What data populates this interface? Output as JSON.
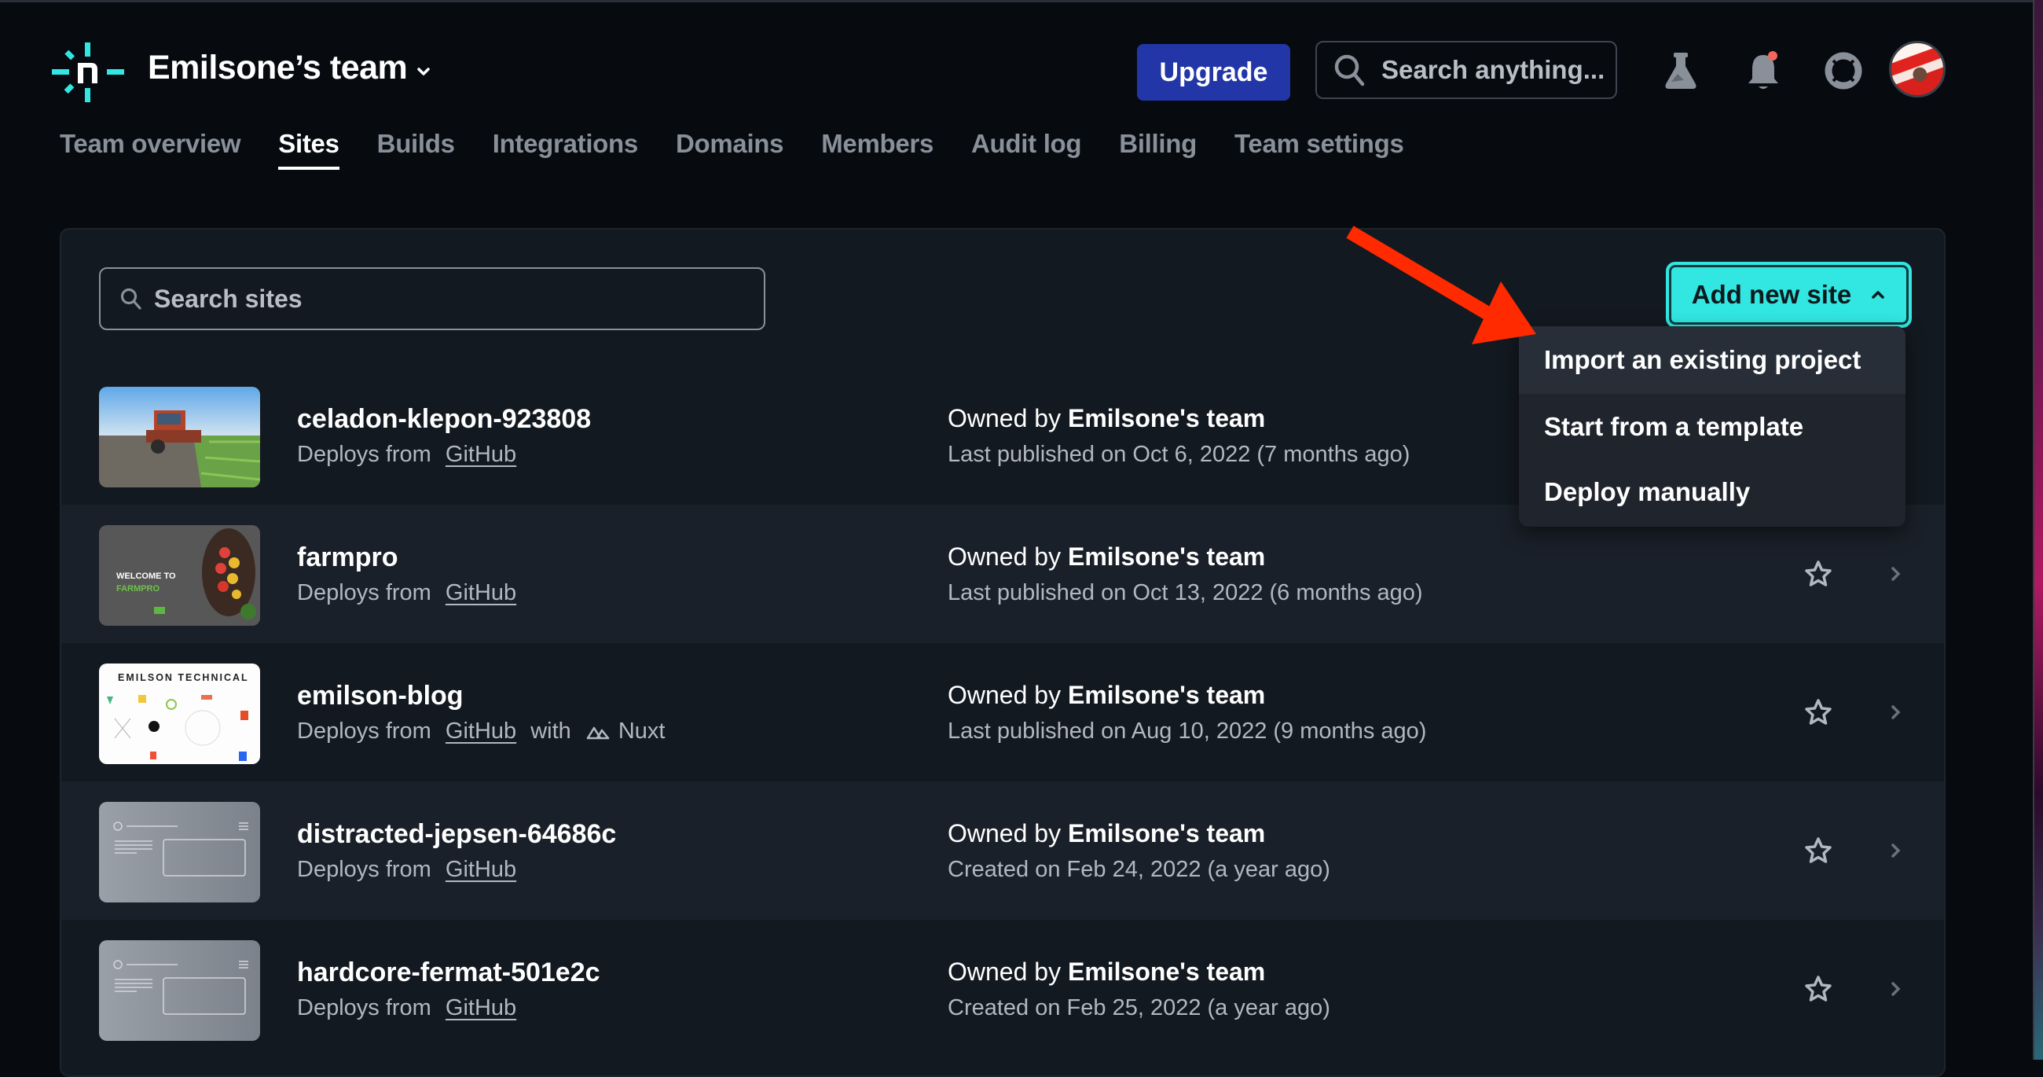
{
  "header": {
    "team_name": "Emilsone’s team",
    "upgrade_label": "Upgrade",
    "search_placeholder": "Search anything...",
    "icons": [
      "netlify-logo-icon",
      "chevron-down-icon",
      "search-icon",
      "flask-icon",
      "bell-icon",
      "lifebuoy-icon",
      "avatar"
    ],
    "notification_dot_color": "#f2675a"
  },
  "tabs": [
    {
      "label": "Team overview",
      "active": false
    },
    {
      "label": "Sites",
      "active": true
    },
    {
      "label": "Builds",
      "active": false
    },
    {
      "label": "Integrations",
      "active": false
    },
    {
      "label": "Domains",
      "active": false
    },
    {
      "label": "Members",
      "active": false
    },
    {
      "label": "Audit log",
      "active": false
    },
    {
      "label": "Billing",
      "active": false
    },
    {
      "label": "Team settings",
      "active": false
    }
  ],
  "sites_panel": {
    "search_placeholder": "Search sites",
    "add_button_label": "Add new site",
    "add_menu": {
      "open": true,
      "items": [
        {
          "label": "Import an existing project",
          "highlighted": true
        },
        {
          "label": "Start from a template",
          "highlighted": false
        },
        {
          "label": "Deploy manually",
          "highlighted": false
        }
      ]
    },
    "sites": [
      {
        "name": "celadon-klepon-923808",
        "deploy_prefix": "Deploys from ",
        "deploy_source": "GitHub",
        "framework": null,
        "owner_prefix": "Owned by ",
        "owner": "Emilsone's team",
        "date": "Last published on Oct 6, 2022 (7 months ago)",
        "thumbnail": "tractor-field"
      },
      {
        "name": "farmpro",
        "deploy_prefix": "Deploys from ",
        "deploy_source": "GitHub",
        "framework": null,
        "owner_prefix": "Owned by ",
        "owner": "Emilsone's team",
        "date": "Last published on Oct 13, 2022 (6 months ago)",
        "thumbnail": "farmpro-welcome",
        "thumb_text": [
          "WELCOME TO",
          "FARMPRO"
        ]
      },
      {
        "name": "emilson-blog",
        "deploy_prefix": "Deploys from ",
        "deploy_source": "GitHub",
        "framework_prefix": " with ",
        "framework": "Nuxt",
        "owner_prefix": "Owned by ",
        "owner": "Emilsone's team",
        "date": "Last published on Aug 10, 2022 (9 months ago)",
        "thumbnail": "emilson-technical",
        "thumb_text": [
          "EMILSON TECHNICAL"
        ]
      },
      {
        "name": "distracted-jepsen-64686c",
        "deploy_prefix": "Deploys from ",
        "deploy_source": "GitHub",
        "framework": null,
        "owner_prefix": "Owned by ",
        "owner": "Emilsone's team",
        "date": "Created on Feb 24, 2022 (a year ago)",
        "thumbnail": "placeholder"
      },
      {
        "name": "hardcore-fermat-501e2c",
        "deploy_prefix": "Deploys from ",
        "deploy_source": "GitHub",
        "framework": null,
        "owner_prefix": "Owned by ",
        "owner": "Emilsone's team",
        "date": "Created on Feb 25, 2022 (a year ago)",
        "thumbnail": "placeholder"
      }
    ]
  },
  "annotation": {
    "type": "red-arrow",
    "color": "#ff2a00",
    "points_to": "Import an existing project"
  },
  "colors": {
    "brand_teal": "#32e6e2",
    "upgrade_blue": "#2236a8",
    "background": "#070b10",
    "panel": "#131920",
    "row_alt": "#1a2029"
  }
}
